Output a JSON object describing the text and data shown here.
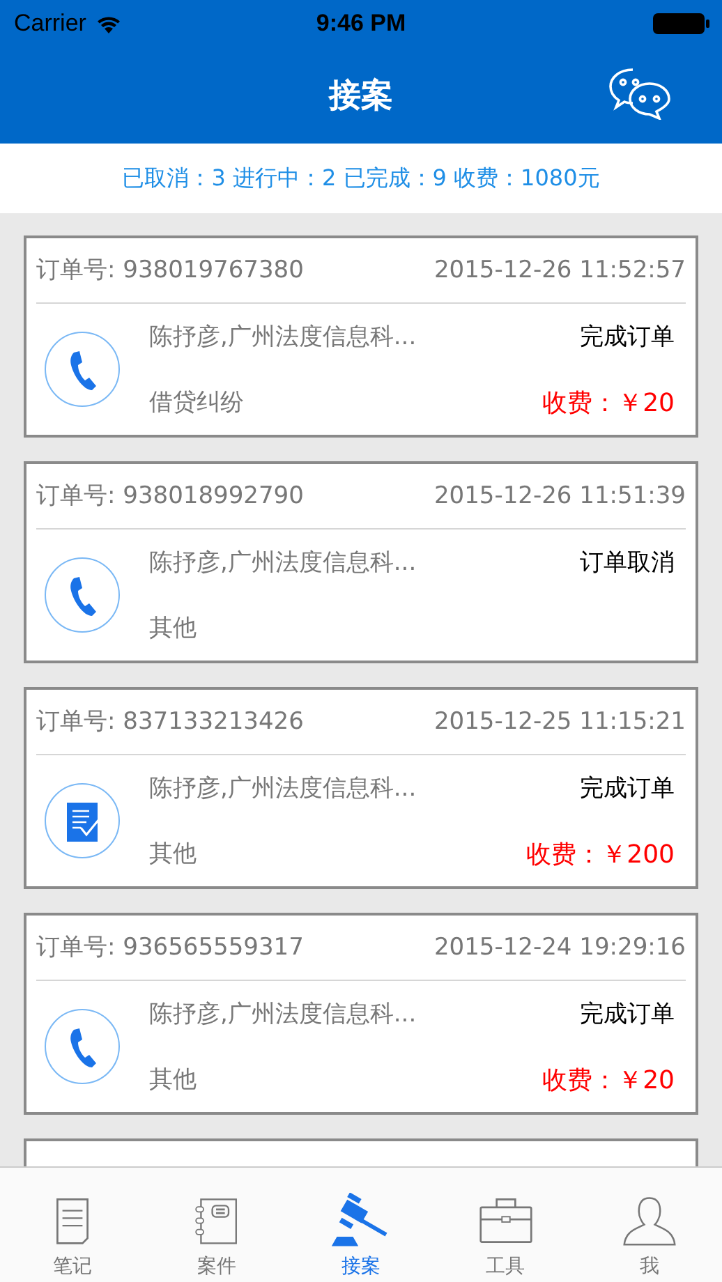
{
  "status_bar": {
    "carrier": "Carrier",
    "time": "9:46 PM"
  },
  "nav": {
    "title": "接案"
  },
  "summary": "已取消：3 进行中：2 已完成：9 收费：1080元",
  "orders": [
    {
      "order_label": "订单号: 938019767380",
      "datetime": "2015-12-26 11:52:57",
      "kind": "phone",
      "client": "陈抒彦,广州法度信息科...",
      "category": "借贷纠纷",
      "status": "完成订单",
      "fee": "收费：￥20"
    },
    {
      "order_label": "订单号: 938018992790",
      "datetime": "2015-12-26 11:51:39",
      "kind": "phone",
      "client": "陈抒彦,广州法度信息科...",
      "category": "其他",
      "status": "订单取消"
    },
    {
      "order_label": "订单号: 837133213426",
      "datetime": "2015-12-25 11:15:21",
      "kind": "document",
      "client": "陈抒彦,广州法度信息科...",
      "category": "其他",
      "status": "完成订单",
      "fee": "收费：￥200"
    },
    {
      "order_label": "订单号: 936565559317",
      "datetime": "2015-12-24 19:29:16",
      "kind": "phone",
      "client": "陈抒彦,广州法度信息科...",
      "category": "其他",
      "status": "完成订单",
      "fee": "收费：￥20"
    },
    {
      "kind": "hidden"
    }
  ],
  "tab_bar": [
    {
      "label": "笔记",
      "kind": "notes",
      "selected": false
    },
    {
      "label": "案件",
      "kind": "cases",
      "selected": false
    },
    {
      "label": "接案",
      "kind": "gavel",
      "selected": true
    },
    {
      "label": "工具",
      "kind": "toolbox",
      "selected": false
    },
    {
      "label": "我",
      "kind": "person",
      "selected": false
    }
  ]
}
